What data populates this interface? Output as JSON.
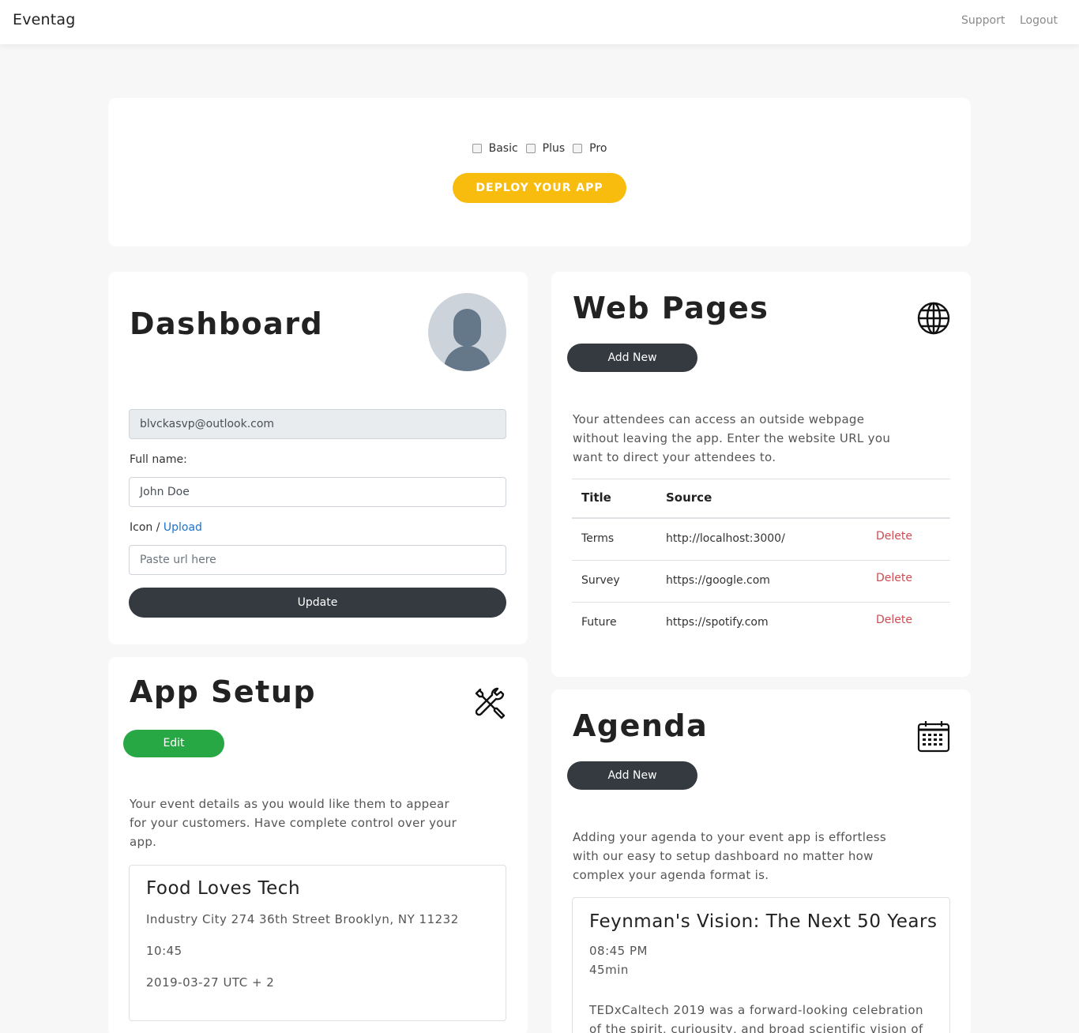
{
  "nav": {
    "brand": "Eventag",
    "support": "Support",
    "logout": "Logout"
  },
  "deploy": {
    "plans": [
      {
        "label": "Basic"
      },
      {
        "label": "Plus"
      },
      {
        "label": "Pro"
      }
    ],
    "button": "DEPLOY YOUR APP"
  },
  "dashboard": {
    "title": "Dashboard",
    "email": "blvckasvp@outlook.com",
    "full_name_label": "Full name:",
    "full_name_value": "John Doe",
    "icon_label": "Icon /",
    "upload_link": "Upload",
    "icon_placeholder": "Paste url here",
    "update_button": "Update"
  },
  "web_pages": {
    "title": "Web Pages",
    "add_button": "Add New",
    "description": "Your attendees can access an outside webpage without leaving the app. Enter the website URL you want to direct your attendees to.",
    "columns": [
      "Title",
      "Source"
    ],
    "rows": [
      {
        "title": "Terms",
        "source": "http://localhost:3000/",
        "action": "Delete"
      },
      {
        "title": "Survey",
        "source": "https://google.com",
        "action": "Delete"
      },
      {
        "title": "Future",
        "source": "https://spotify.com",
        "action": "Delete"
      }
    ]
  },
  "app_setup": {
    "title": "App Setup",
    "edit_button": "Edit",
    "description": "Your event details as you would like them to appear for your customers. Have complete control over your app.",
    "event": {
      "name": "Food Loves Tech",
      "address": "Industry City 274 36th Street Brooklyn, NY 11232",
      "time": "10:45",
      "date": "2019-03-27 UTC + 2"
    }
  },
  "agenda": {
    "title": "Agenda",
    "add_button": "Add New",
    "description": "Adding your agenda to your event app is effortless with our easy to setup dashboard no matter how complex your agenda format is.",
    "item": {
      "title": "Feynman's Vision: The Next 50 Years",
      "time": "08:45 PM",
      "duration": "45min",
      "summary": "TEDxCaltech 2019 was a forward-looking celebration of the spirit, curiousity, and broad scientific vision of"
    }
  },
  "colors": {
    "accent_yellow": "#f8bc0e",
    "dark": "#343a40",
    "green": "#28a745",
    "danger": "#d04a52",
    "link": "#1a73c8"
  }
}
